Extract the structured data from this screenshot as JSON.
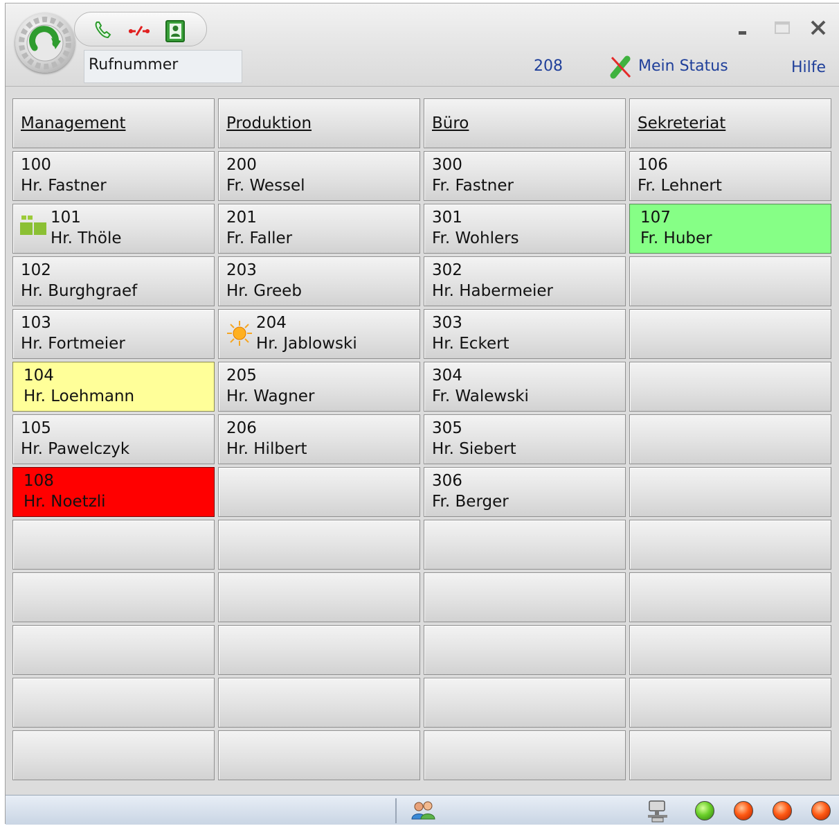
{
  "toolbar": {
    "number_placeholder": "Rufnummer",
    "own_extension": "208",
    "my_status_label": "Mein Status",
    "help_label": "Hilfe"
  },
  "groups": [
    {
      "header": "Management",
      "entries": [
        {
          "ext": "100",
          "name": "Hr. Fastner"
        },
        {
          "ext": "101",
          "name": "Hr. Thöle",
          "icon": "messenger-icon"
        },
        {
          "ext": "102",
          "name": "Hr. Burghgraef"
        },
        {
          "ext": "103",
          "name": "Hr. Fortmeier"
        },
        {
          "ext": "104",
          "name": "Hr. Loehmann",
          "color": "#ffff99"
        },
        {
          "ext": "105",
          "name": "Hr. Pawelczyk"
        },
        {
          "ext": "108",
          "name": "Hr. Noetzli",
          "color": "#ff0000"
        }
      ]
    },
    {
      "header": "Produktion",
      "entries": [
        {
          "ext": "200",
          "name": "Fr. Wessel"
        },
        {
          "ext": "201",
          "name": "Fr. Faller"
        },
        {
          "ext": "203",
          "name": "Hr. Greeb"
        },
        {
          "ext": "204",
          "name": "Hr. Jablowski",
          "icon": "sun-icon"
        },
        {
          "ext": "205",
          "name": "Hr. Wagner"
        },
        {
          "ext": "206",
          "name": "Hr. Hilbert"
        }
      ]
    },
    {
      "header": "Büro",
      "entries": [
        {
          "ext": "300",
          "name": "Fr. Fastner"
        },
        {
          "ext": "301",
          "name": "Fr. Wohlers"
        },
        {
          "ext": "302",
          "name": "Hr. Habermeier"
        },
        {
          "ext": "303",
          "name": "Hr. Eckert"
        },
        {
          "ext": "304",
          "name": "Fr. Walewski"
        },
        {
          "ext": "305",
          "name": "Hr. Siebert"
        },
        {
          "ext": "306",
          "name": "Fr. Berger"
        }
      ]
    },
    {
      "header": "Sekreteriat",
      "entries": [
        {
          "ext": "106",
          "name": "Fr. Lehnert"
        },
        {
          "ext": "107",
          "name": "Fr. Huber",
          "color": "#86ff86"
        }
      ]
    }
  ],
  "status_colors": {
    "busy": "#ff0000",
    "available": "#86ff86",
    "ringing": "#ffff99"
  },
  "statusbar": {
    "indicators": [
      "green",
      "orange",
      "orange",
      "orange"
    ]
  }
}
